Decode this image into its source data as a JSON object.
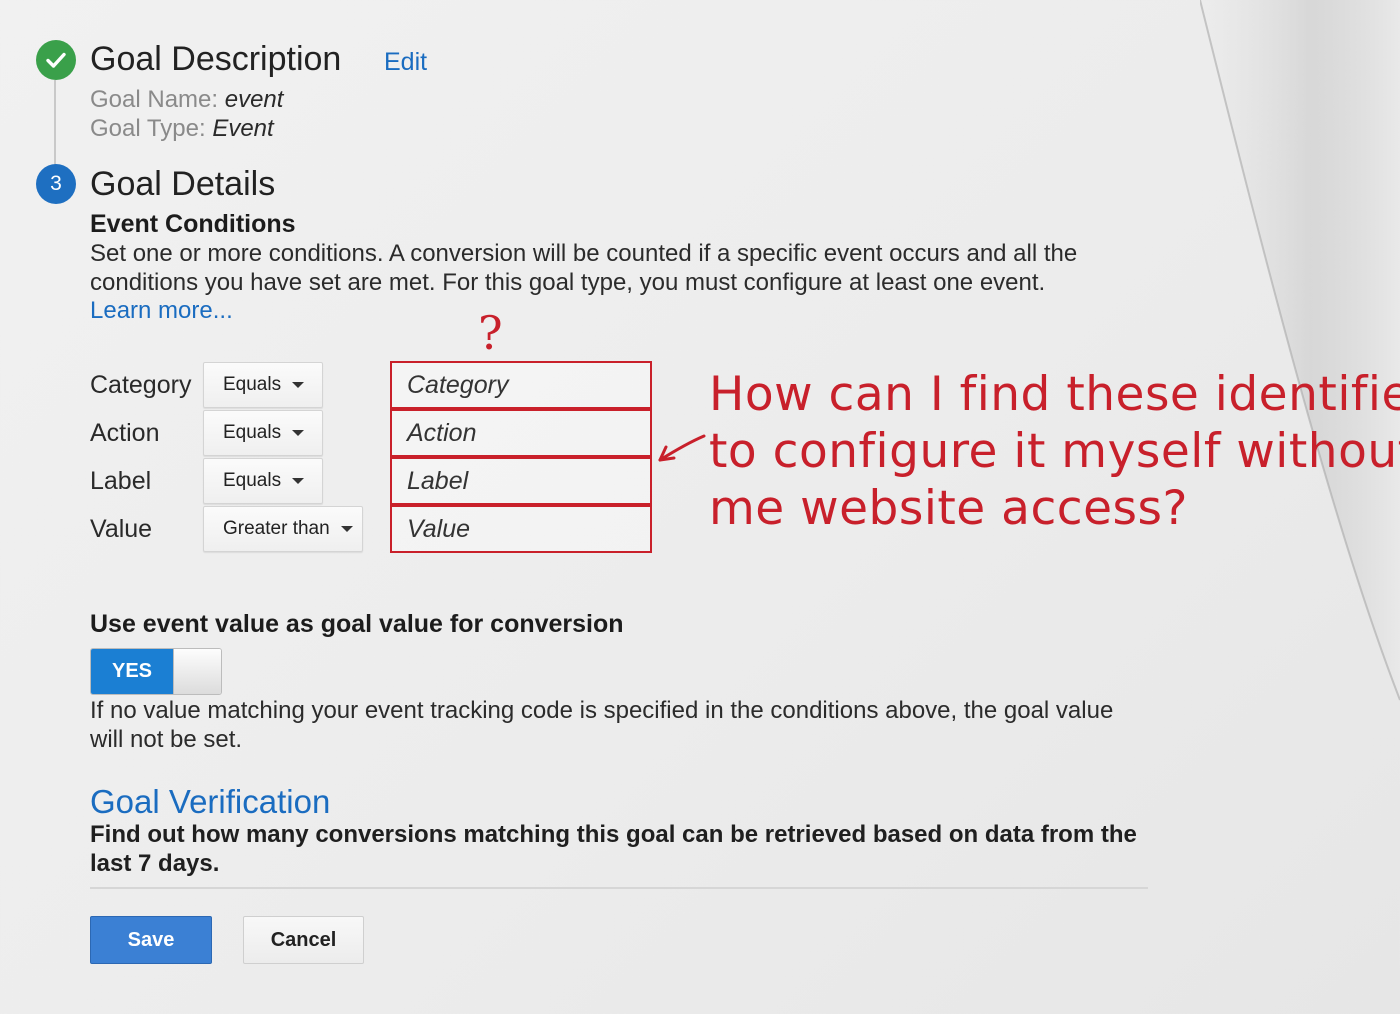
{
  "goal_description": {
    "title": "Goal Description",
    "edit_label": "Edit",
    "name_label": "Goal Name:",
    "name_value": "event",
    "type_label": "Goal Type:",
    "type_value": "Event"
  },
  "goal_details": {
    "step_number": "3",
    "title": "Goal Details",
    "conditions_title": "Event Conditions",
    "description_line1": "Set one or more conditions. A conversion will be counted if a specific event occurs and all the",
    "description_line2": "conditions you have set are met. For this goal type, you must configure at least one event.",
    "learn_more": "Learn more...",
    "rows": [
      {
        "label": "Category",
        "operator": "Equals",
        "placeholder": "Category"
      },
      {
        "label": "Action",
        "operator": "Equals",
        "placeholder": "Action"
      },
      {
        "label": "Label",
        "operator": "Equals",
        "placeholder": "Label"
      },
      {
        "label": "Value",
        "operator": "Greater than",
        "placeholder": "Value"
      }
    ]
  },
  "annotation": {
    "question_mark": "?",
    "line1": "How can I find these identifiers",
    "line2": "to configure it myself without",
    "line3": "me website access?",
    "color": "#c8202b"
  },
  "event_value": {
    "title": "Use event value as goal value for conversion",
    "toggle_label": "YES",
    "toggle_state": true,
    "note_line1": "If no value matching your event tracking code is specified in the conditions above, the goal value",
    "note_line2": "will not be set."
  },
  "goal_verification": {
    "title": "Goal Verification",
    "text_line1": "Find out how many conversions matching this goal can be retrieved based on data from the",
    "text_line2": "last 7 days."
  },
  "actions": {
    "save_label": "Save",
    "cancel_label": "Cancel"
  },
  "colors": {
    "accent_blue": "#1a6cc0",
    "step_done_green": "#3aa04a",
    "annotation_red": "#c8202b"
  }
}
